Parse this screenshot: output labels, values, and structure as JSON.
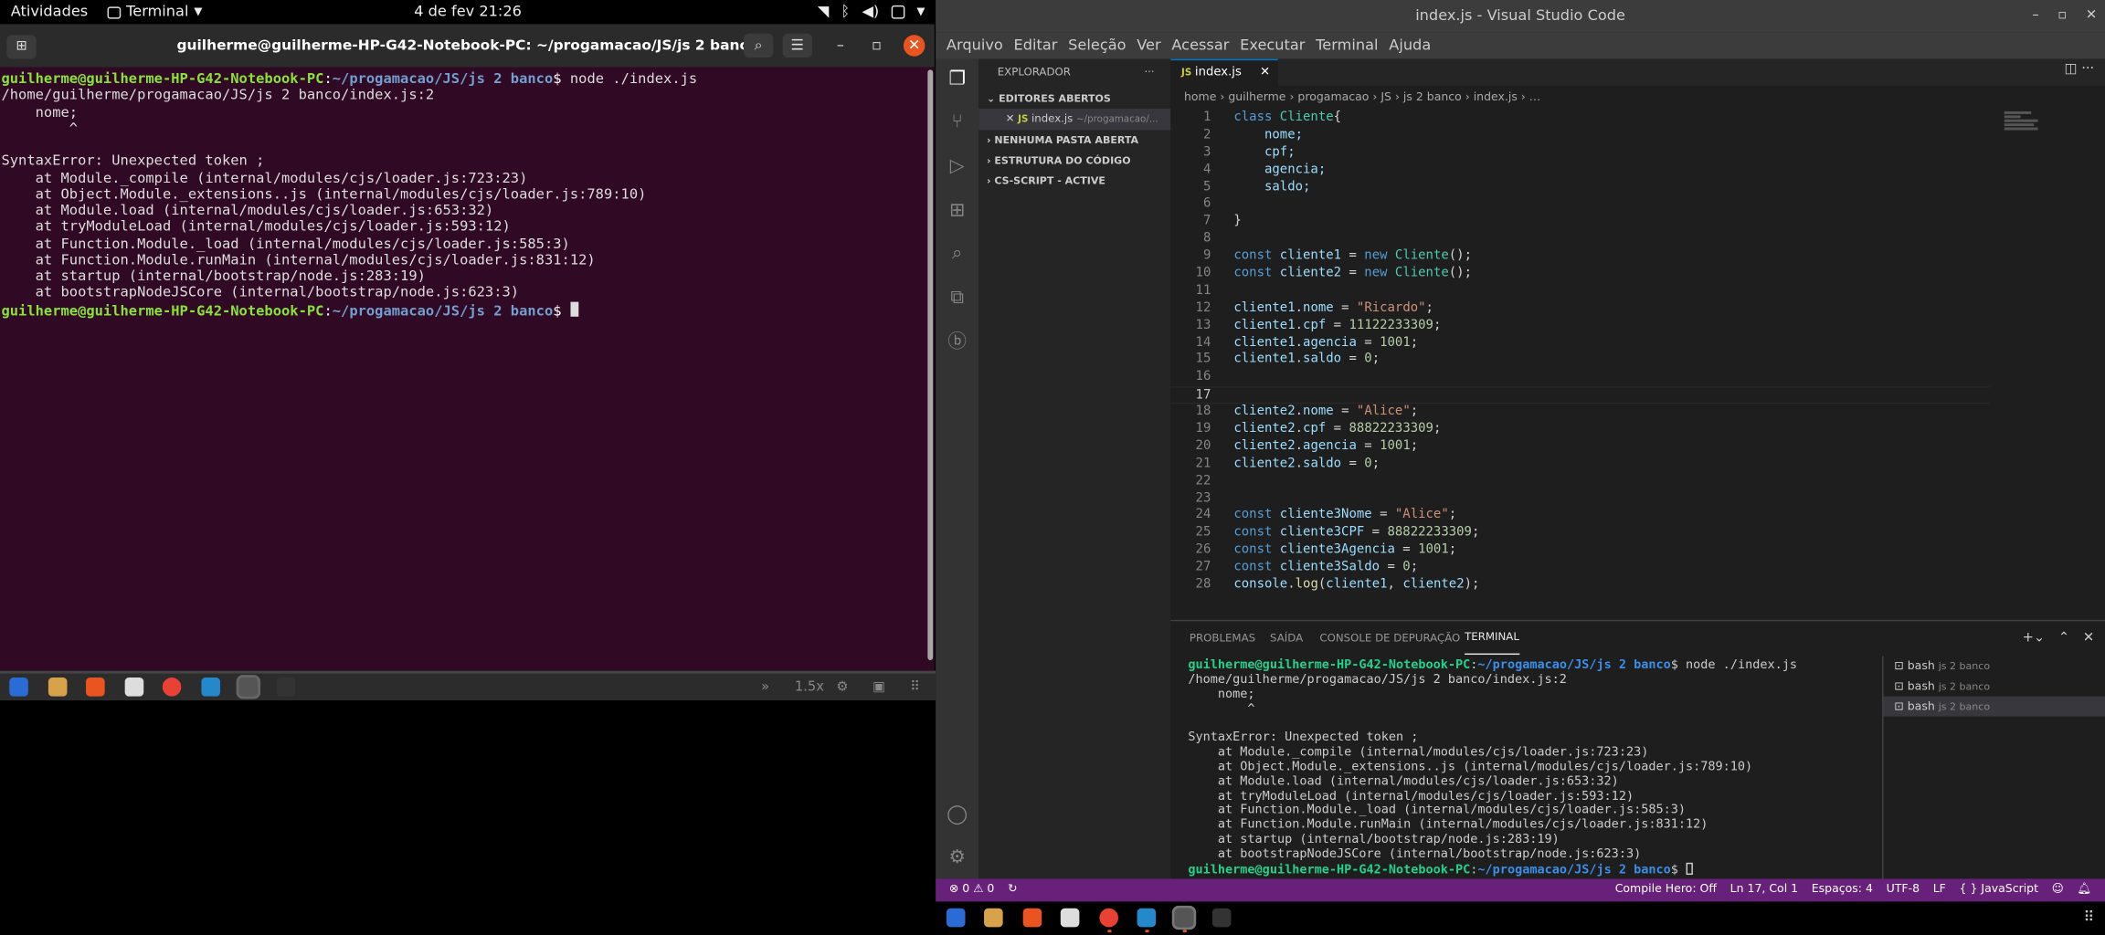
{
  "topbar": {
    "activities": "Atividades",
    "app": "Terminal",
    "clock": "4 de fev  21:26"
  },
  "gterm": {
    "title": "guilherme@guilherme-HP-G42-Notebook-PC: ~/progamacao/JS/js 2 banco",
    "prompt_user": "guilherme@guilherme-HP-G42-Notebook-PC",
    "prompt_path": "~/progamacao/JS/js 2 banco",
    "command": " node ./index.js",
    "output": [
      "/home/guilherme/progamacao/JS/js 2 banco/index.js:2",
      "    nome;",
      "        ^",
      "",
      "SyntaxError: Unexpected token ;",
      "    at Module._compile (internal/modules/cjs/loader.js:723:23)",
      "    at Object.Module._extensions..js (internal/modules/cjs/loader.js:789:10)",
      "    at Module.load (internal/modules/cjs/loader.js:653:32)",
      "    at tryModuleLoad (internal/modules/cjs/loader.js:593:12)",
      "    at Function.Module._load (internal/modules/cjs/loader.js:585:3)",
      "    at Function.Module.runMain (internal/modules/cjs/loader.js:831:12)",
      "    at startup (internal/bootstrap/node.js:283:19)",
      "    at bootstrapNodeJSCore (internal/bootstrap/node.js:623:3)"
    ]
  },
  "vmbar": {
    "zoom": "1.5x"
  },
  "vscode": {
    "title": "index.js - Visual Studio Code",
    "menu": [
      "Arquivo",
      "Editar",
      "Seleção",
      "Ver",
      "Acessar",
      "Executar",
      "Terminal",
      "Ajuda"
    ],
    "explorer": {
      "header": "EXPLORADOR",
      "open_editors": "EDITORES ABERTOS",
      "open_file": "index.js",
      "open_file_path": "~/progamacao/...",
      "no_folder": "NENHUMA PASTA ABERTA",
      "outline": "ESTRUTURA DO CÓDIGO",
      "cs_script": "CS-SCRIPT - ACTIVE"
    },
    "tab": "index.js",
    "breadcrumb": "home  ›  guilherme  ›  progamacao  ›  JS  ›  js 2 banco  ›  index.js  ›  …",
    "code": [
      [
        [
          "class ",
          "kw"
        ],
        [
          "Cliente",
          "cl"
        ],
        [
          "{",
          "pl"
        ]
      ],
      [
        [
          "    nome;",
          "vr"
        ]
      ],
      [
        [
          "    cpf;",
          "vr"
        ]
      ],
      [
        [
          "    agencia;",
          "vr"
        ]
      ],
      [
        [
          "    saldo;",
          "vr"
        ]
      ],
      [],
      [
        [
          "}",
          "pl"
        ]
      ],
      [],
      [
        [
          "const ",
          "kw"
        ],
        [
          "cliente1",
          "vr"
        ],
        [
          " = ",
          "pl"
        ],
        [
          "new ",
          "kw"
        ],
        [
          "Cliente",
          "cl"
        ],
        [
          "();",
          "pl"
        ]
      ],
      [
        [
          "const ",
          "kw"
        ],
        [
          "cliente2",
          "vr"
        ],
        [
          " = ",
          "pl"
        ],
        [
          "new ",
          "kw"
        ],
        [
          "Cliente",
          "cl"
        ],
        [
          "();",
          "pl"
        ]
      ],
      [],
      [
        [
          "cliente1",
          "vr"
        ],
        [
          ".",
          "pl"
        ],
        [
          "nome",
          "vr"
        ],
        [
          " = ",
          "pl"
        ],
        [
          "\"Ricardo\"",
          "st"
        ],
        [
          ";",
          "pl"
        ]
      ],
      [
        [
          "cliente1",
          "vr"
        ],
        [
          ".",
          "pl"
        ],
        [
          "cpf",
          "vr"
        ],
        [
          " = ",
          "pl"
        ],
        [
          "11122233309",
          "nm"
        ],
        [
          ";",
          "pl"
        ]
      ],
      [
        [
          "cliente1",
          "vr"
        ],
        [
          ".",
          "pl"
        ],
        [
          "agencia",
          "vr"
        ],
        [
          " = ",
          "pl"
        ],
        [
          "1001",
          "nm"
        ],
        [
          ";",
          "pl"
        ]
      ],
      [
        [
          "cliente1",
          "vr"
        ],
        [
          ".",
          "pl"
        ],
        [
          "saldo",
          "vr"
        ],
        [
          " = ",
          "pl"
        ],
        [
          "0",
          "nm"
        ],
        [
          ";",
          "pl"
        ]
      ],
      [],
      [],
      [
        [
          "cliente2",
          "vr"
        ],
        [
          ".",
          "pl"
        ],
        [
          "nome",
          "vr"
        ],
        [
          " = ",
          "pl"
        ],
        [
          "\"Alice\"",
          "st"
        ],
        [
          ";",
          "pl"
        ]
      ],
      [
        [
          "cliente2",
          "vr"
        ],
        [
          ".",
          "pl"
        ],
        [
          "cpf",
          "vr"
        ],
        [
          " = ",
          "pl"
        ],
        [
          "88822233309",
          "nm"
        ],
        [
          ";",
          "pl"
        ]
      ],
      [
        [
          "cliente2",
          "vr"
        ],
        [
          ".",
          "pl"
        ],
        [
          "agencia",
          "vr"
        ],
        [
          " = ",
          "pl"
        ],
        [
          "1001",
          "nm"
        ],
        [
          ";",
          "pl"
        ]
      ],
      [
        [
          "cliente2",
          "vr"
        ],
        [
          ".",
          "pl"
        ],
        [
          "saldo",
          "vr"
        ],
        [
          " = ",
          "pl"
        ],
        [
          "0",
          "nm"
        ],
        [
          ";",
          "pl"
        ]
      ],
      [],
      [],
      [
        [
          "const ",
          "kw"
        ],
        [
          "cliente3Nome",
          "vr"
        ],
        [
          " = ",
          "pl"
        ],
        [
          "\"Alice\"",
          "st"
        ],
        [
          ";",
          "pl"
        ]
      ],
      [
        [
          "const ",
          "kw"
        ],
        [
          "cliente3CPF",
          "vr"
        ],
        [
          " = ",
          "pl"
        ],
        [
          "88822233309",
          "nm"
        ],
        [
          ";",
          "pl"
        ]
      ],
      [
        [
          "const ",
          "kw"
        ],
        [
          "cliente3Agencia",
          "vr"
        ],
        [
          " = ",
          "pl"
        ],
        [
          "1001",
          "nm"
        ],
        [
          ";",
          "pl"
        ]
      ],
      [
        [
          "const ",
          "kw"
        ],
        [
          "cliente3Saldo",
          "vr"
        ],
        [
          " = ",
          "pl"
        ],
        [
          "0",
          "nm"
        ],
        [
          ";",
          "pl"
        ]
      ],
      [
        [
          "console",
          "vr"
        ],
        [
          ".",
          "pl"
        ],
        [
          "log",
          "fn"
        ],
        [
          "(",
          "pl"
        ],
        [
          "cliente1",
          "vr"
        ],
        [
          ", ",
          "pl"
        ],
        [
          "cliente2",
          "vr"
        ],
        [
          ");",
          "pl"
        ]
      ]
    ],
    "current_line": 17,
    "panel_tabs": [
      "PROBLEMAS",
      "SAÍDA",
      "CONSOLE DE DEPURAÇÃO",
      "TERMINAL"
    ],
    "terminals": [
      {
        "name": "bash",
        "dir": "js 2 banco"
      },
      {
        "name": "bash",
        "dir": "js 2 banco"
      },
      {
        "name": "bash",
        "dir": "js 2 banco"
      }
    ],
    "terminal_output": [
      "/home/guilherme/progamacao/JS/js 2 banco/index.js:2",
      "    nome;",
      "        ^",
      "",
      "SyntaxError: Unexpected token ;",
      "    at Module._compile (internal/modules/cjs/loader.js:723:23)",
      "    at Object.Module._extensions..js (internal/modules/cjs/loader.js:789:10)",
      "    at Module.load (internal/modules/cjs/loader.js:653:32)",
      "    at tryModuleLoad (internal/modules/cjs/loader.js:593:12)",
      "    at Function.Module._load (internal/modules/cjs/loader.js:585:3)",
      "    at Function.Module.runMain (internal/modules/cjs/loader.js:831:12)",
      "    at startup (internal/bootstrap/node.js:283:19)",
      "    at bootstrapNodeJSCore (internal/bootstrap/node.js:623:3)"
    ],
    "status": {
      "errors": "0",
      "warnings": "0",
      "compile_hero": "Compile Hero: Off",
      "position": "Ln 17, Col 1",
      "spaces": "Espaços: 4",
      "encoding": "UTF-8",
      "eol": "LF",
      "language": "JavaScript"
    }
  },
  "colors": {
    "terminal_bg": "#300a24",
    "statusbar": "#68217a",
    "accent": "#007acc",
    "ubuntu_orange": "#e95420"
  }
}
